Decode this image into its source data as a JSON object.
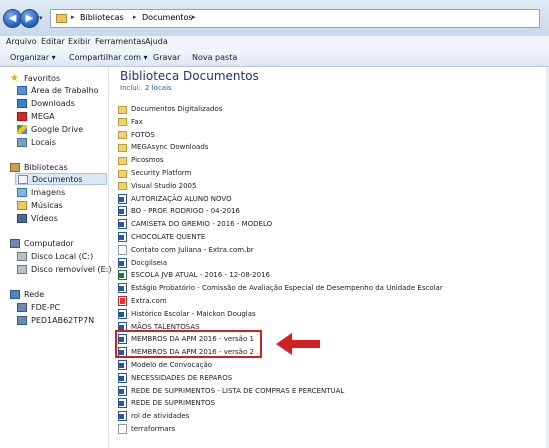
{
  "address_bar": {
    "back_icon": "back-arrow-icon",
    "forward_icon": "forward-arrow-icon",
    "breadcrumb": [
      "Bibliotecas",
      "Documentos"
    ]
  },
  "menu": [
    "Arquivo",
    "Editar",
    "Exibir",
    "Ferramentas",
    "Ajuda"
  ],
  "command_bar": {
    "organize": "Organizar ▾",
    "share": "Compartilhar com ▾",
    "burn": "Gravar",
    "new_folder": "Nova pasta"
  },
  "nav": {
    "favorites_header": "Favoritos",
    "favorites": [
      "Área de Trabalho",
      "Downloads",
      "MEGA",
      "Google Drive",
      "Locais"
    ],
    "libraries_header": "Bibliotecas",
    "libraries": [
      "Documentos",
      "Imagens",
      "Músicas",
      "Vídeos"
    ],
    "computer_header": "Computador",
    "computer": [
      "Disco Local (C:)",
      "Disco removível (E:)"
    ],
    "network_header": "Rede",
    "network": [
      "FDE-PC",
      "PED1AB62TP7N"
    ]
  },
  "library": {
    "title": "Biblioteca Documentos",
    "includes_label": "Inclui:",
    "includes_link": "2 locais"
  },
  "files": [
    {
      "name": "Documentos Digitalizados",
      "type": "folder"
    },
    {
      "name": "Fax",
      "type": "folder"
    },
    {
      "name": "FOTOS",
      "type": "folder"
    },
    {
      "name": "MEGAsync Downloads",
      "type": "folder"
    },
    {
      "name": "Picosmos",
      "type": "folder"
    },
    {
      "name": "Security Platform",
      "type": "folder"
    },
    {
      "name": "Visual Studio 2005",
      "type": "folder"
    },
    {
      "name": "AUTORIZAÇÃO ALUNO NOVO",
      "type": "word"
    },
    {
      "name": "BO - PROF. RODRIGO - 04-2016",
      "type": "word"
    },
    {
      "name": "CAMISETA DO GREMIO - 2016 - MODELO",
      "type": "word"
    },
    {
      "name": "CHOCOLATE QUENTE",
      "type": "word"
    },
    {
      "name": "Contato com Juliana - Extra.com.br",
      "type": "blank"
    },
    {
      "name": "Docgilseia",
      "type": "word"
    },
    {
      "name": "ESCOLA JVB ATUAL - 2016 - 12-08-2016",
      "type": "excel"
    },
    {
      "name": "Estágio Probatório - Comissão de Avaliação Especial de Desempenho da Unidade Escolar",
      "type": "word"
    },
    {
      "name": "Extra.com",
      "type": "pdf"
    },
    {
      "name": "Histórico Escolar - Maickon Douglas",
      "type": "word"
    },
    {
      "name": "MÃOS TALENTOSAS",
      "type": "word"
    },
    {
      "name": "MEMBROS DA APM 2016 - versão 1",
      "type": "word"
    },
    {
      "name": "MEMBROS DA APM 2016 - versão 2",
      "type": "word"
    },
    {
      "name": "Modelo de Convocação",
      "type": "word"
    },
    {
      "name": "NECESSIDADES DE REPAROS",
      "type": "word"
    },
    {
      "name": "REDE DE SUPRIMENTOS - LISTA DE COMPRAS E PERCENTUAL",
      "type": "word"
    },
    {
      "name": "REDE DE SUPRIMENTOS",
      "type": "word"
    },
    {
      "name": "rol de atividades",
      "type": "word"
    },
    {
      "name": "terraformars",
      "type": "blank"
    }
  ],
  "annotation": {
    "box_color": "#d21f1f",
    "arrow_color": "#d21f1f"
  }
}
